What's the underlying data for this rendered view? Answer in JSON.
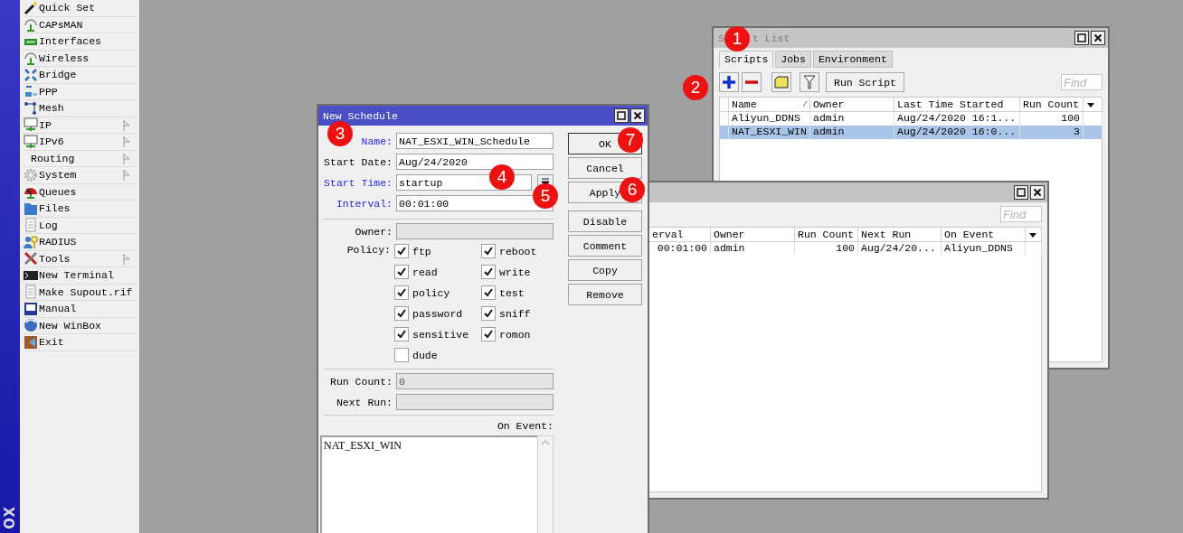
{
  "sidebar": {
    "brand": "OX",
    "items": [
      {
        "label": "Quick Set",
        "has_submenu": false
      },
      {
        "label": "CAPsMAN",
        "has_submenu": false
      },
      {
        "label": "Interfaces",
        "has_submenu": false
      },
      {
        "label": "Wireless",
        "has_submenu": false
      },
      {
        "label": "Bridge",
        "has_submenu": false
      },
      {
        "label": "PPP",
        "has_submenu": false
      },
      {
        "label": "Mesh",
        "has_submenu": false
      },
      {
        "label": "IP",
        "has_submenu": true
      },
      {
        "label": "IPv6",
        "has_submenu": true
      },
      {
        "label": "Routing",
        "has_submenu": true
      },
      {
        "label": "System",
        "has_submenu": true
      },
      {
        "label": "Queues",
        "has_submenu": false
      },
      {
        "label": "Files",
        "has_submenu": false
      },
      {
        "label": "Log",
        "has_submenu": false
      },
      {
        "label": "RADIUS",
        "has_submenu": false
      },
      {
        "label": "Tools",
        "has_submenu": true
      },
      {
        "label": "New Terminal",
        "has_submenu": false
      },
      {
        "label": "Make Supout.rif",
        "has_submenu": false
      },
      {
        "label": "Manual",
        "has_submenu": false
      },
      {
        "label": "New WinBox",
        "has_submenu": false
      },
      {
        "label": "Exit",
        "has_submenu": false
      }
    ]
  },
  "script_list": {
    "title_parts": [
      "S",
      "t List"
    ],
    "tabs": [
      {
        "label": "Scripts",
        "selected": true
      },
      {
        "label": "Jobs",
        "selected": false
      },
      {
        "label": "Environment",
        "selected": false
      }
    ],
    "run_button": "Run Script",
    "find_placeholder": "Find",
    "columns": [
      {
        "label": "Name",
        "sorted": true,
        "numeric": false
      },
      {
        "label": "Owner",
        "sorted": false,
        "numeric": false
      },
      {
        "label": "Last Time Started",
        "sorted": false,
        "numeric": false
      },
      {
        "label": "Run Count",
        "sorted": false,
        "numeric": true
      }
    ],
    "rows": [
      {
        "cells": [
          "Aliyun_DDNS",
          "admin",
          "Aug/24/2020 16:1...",
          "100"
        ],
        "selected": false
      },
      {
        "cells": [
          "NAT_ESXI_WIN",
          "admin",
          "Aug/24/2020 16:0...",
          "3"
        ],
        "selected": true
      }
    ]
  },
  "scheduler": {
    "find_placeholder": "Find",
    "columns": [
      {
        "label": "erval",
        "sorted": false,
        "numeric": true
      },
      {
        "label": "Owner",
        "sorted": false,
        "numeric": false
      },
      {
        "label": "Run Count",
        "sorted": false,
        "numeric": true
      },
      {
        "label": "Next Run",
        "sorted": false,
        "numeric": false
      },
      {
        "label": "On Event",
        "sorted": false,
        "numeric": false
      }
    ],
    "rows": [
      {
        "cells": [
          "00:01:00",
          "admin",
          "100",
          "Aug/24/20...",
          "Aliyun_DDNS"
        ],
        "selected": false
      }
    ]
  },
  "new_schedule": {
    "title": "New Schedule",
    "fields": [
      {
        "label": "Name:",
        "value": "NAT_ESXI_WIN_Schedule",
        "highlighted": true,
        "kind": "text"
      },
      {
        "label": "Start Date:",
        "value": "Aug/24/2020",
        "highlighted": false,
        "kind": "text"
      },
      {
        "label": "Start Time:",
        "value": "startup",
        "highlighted": true,
        "kind": "dropdown"
      },
      {
        "label": "Interval:",
        "value": "00:01:00",
        "highlighted": true,
        "kind": "text"
      }
    ],
    "owner": {
      "label": "Owner:",
      "disabled": true
    },
    "policy_label": "Policy:",
    "policies": [
      {
        "label": "ftp",
        "checked": true
      },
      {
        "label": "reboot",
        "checked": true
      },
      {
        "label": "read",
        "checked": true
      },
      {
        "label": "write",
        "checked": true
      },
      {
        "label": "policy",
        "checked": true
      },
      {
        "label": "test",
        "checked": true
      },
      {
        "label": "password",
        "checked": true
      },
      {
        "label": "sniff",
        "checked": true
      },
      {
        "label": "sensitive",
        "checked": true
      },
      {
        "label": "romon",
        "checked": true
      },
      {
        "label": "dude",
        "checked": false
      }
    ],
    "status_fields": [
      {
        "label": "Run Count:",
        "value": "0",
        "disabled": true
      },
      {
        "label": "Next Run:",
        "disabled": true
      }
    ],
    "on_event_label": "On Event:",
    "on_event": "NAT_ESXI_WIN",
    "buttons": [
      {
        "label": "OK",
        "default": true
      },
      {
        "label": "Cancel",
        "default": false
      },
      {
        "label": "Apply",
        "default": false
      },
      {
        "label": "Disable",
        "default": false
      },
      {
        "label": "Comment",
        "default": false
      },
      {
        "label": "Copy",
        "default": false
      },
      {
        "label": "Remove",
        "default": false
      }
    ]
  },
  "annotations": [
    "1",
    "2",
    "3",
    "4",
    "5",
    "6",
    "7"
  ]
}
